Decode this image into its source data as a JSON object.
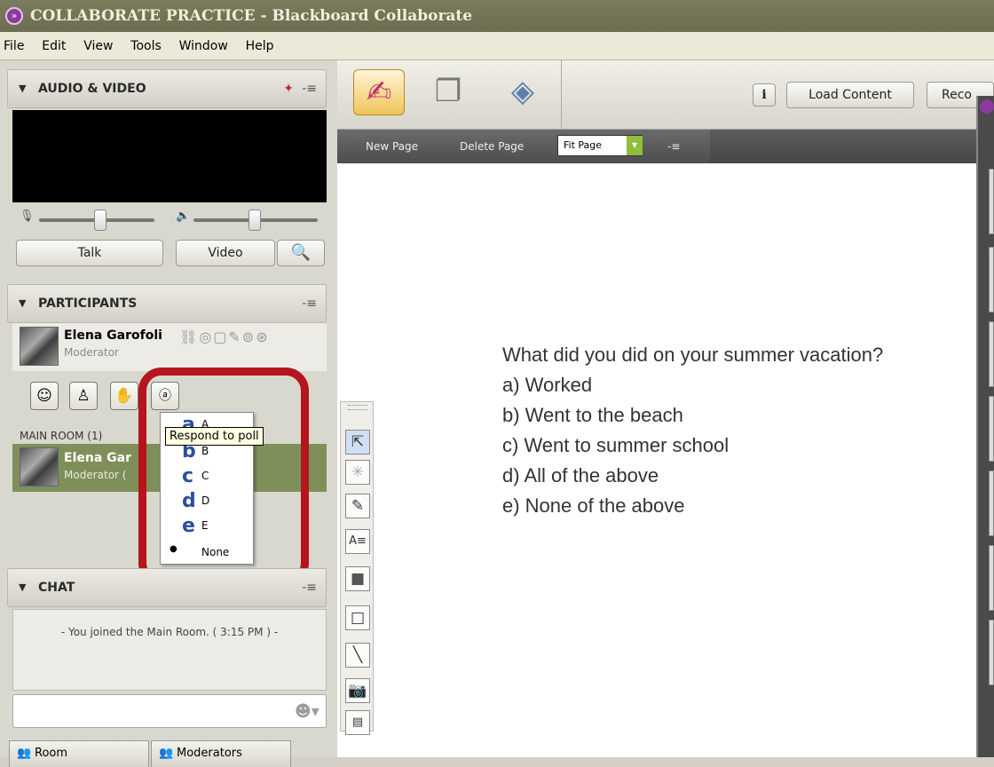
{
  "window": {
    "title": "COLLABORATE PRACTICE - Blackboard Collaborate"
  },
  "menu": [
    "File",
    "Edit",
    "View",
    "Tools",
    "Window",
    "Help"
  ],
  "audio_video": {
    "title": "AUDIO & VIDEO",
    "talk_label": "Talk",
    "video_label": "Video"
  },
  "participants": {
    "title": "PARTICIPANTS",
    "me": {
      "name": "Elena Garofoli",
      "role": "Moderator"
    },
    "main_room_label": "MAIN ROOM (1)",
    "room_entry": {
      "name": "Elena Gar",
      "role": "Moderator ("
    }
  },
  "poll_menu": {
    "tooltip": "Respond to poll",
    "items": [
      {
        "big": "a",
        "small": "A"
      },
      {
        "big": "b",
        "small": "B"
      },
      {
        "big": "c",
        "small": "C"
      },
      {
        "big": "d",
        "small": "D"
      },
      {
        "big": "e",
        "small": "E"
      }
    ],
    "none_label": "None"
  },
  "chat": {
    "title": "CHAT",
    "message": "- You joined the Main Room. ( 3:15 PM ) -"
  },
  "bottom_tabs": {
    "room": "Room",
    "moderators": "Moderators"
  },
  "content_toolbar": {
    "info_label": "i",
    "load_content": "Load Content",
    "record_partial": "Reco"
  },
  "whiteboard_bar": {
    "new_page": "New Page",
    "delete_page": "Delete Page",
    "fit_page": "Fit Page"
  },
  "whiteboard": {
    "question": "What did you did on your summer vacation?",
    "options": [
      "a) Worked",
      "b) Went to the beach",
      "c) Went to summer school",
      "d) All of the above",
      "e) None of the above"
    ]
  },
  "colors": {
    "title_bar": "#6d6d52",
    "highlight_ring": "#b5151c",
    "participant_selected": "#7f8f5a",
    "poll_letter": "#2c4f9e"
  }
}
